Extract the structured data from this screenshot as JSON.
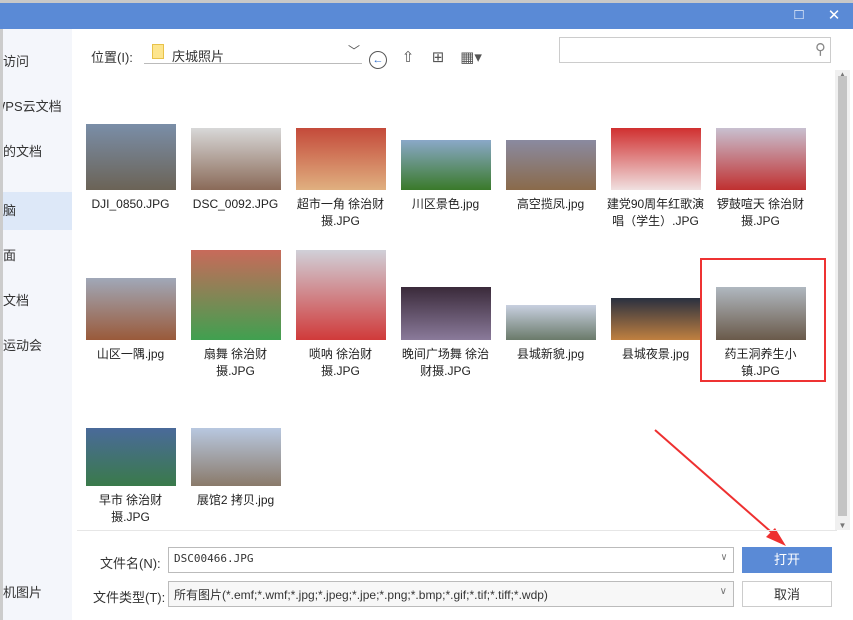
{
  "title_bar": {
    "maximize_icon": "□",
    "close_icon": "✕"
  },
  "sidebar": {
    "items": [
      {
        "label": "最近访问"
      },
      {
        "label": "WPS云文档"
      },
      {
        "label": "我的文档"
      },
      {
        "label": "此电脑"
      },
      {
        "label": "桌面"
      },
      {
        "label": "我的文档"
      },
      {
        "label": "校运动会"
      },
      {
        "label": "手机图片"
      }
    ]
  },
  "location": {
    "label": "位置(I):",
    "value": "庆城照片"
  },
  "files": [
    {
      "name": "DJI_0850.JPG",
      "colors": [
        "#7a8ea8",
        "#6b6356"
      ]
    },
    {
      "name": "DSC_0092.JPG",
      "colors": [
        "#d8d8d8",
        "#8a6a58"
      ]
    },
    {
      "name": "超市一角  徐治财摄.JPG",
      "colors": [
        "#c44a3a",
        "#e0b080"
      ]
    },
    {
      "name": "川区景色.jpg",
      "colors": [
        "#8aa8c8",
        "#3a7a2a"
      ]
    },
    {
      "name": "高空揽凤.jpg",
      "colors": [
        "#8a8aa0",
        "#8a6a4a"
      ]
    },
    {
      "name": "建党90周年红歌演唱（学生）.JPG",
      "colors": [
        "#d03030",
        "#f0e0e0"
      ]
    },
    {
      "name": "锣鼓喧天  徐治财摄.JPG",
      "colors": [
        "#c8c0d0",
        "#c03030"
      ]
    },
    {
      "name": "山区一隅.jpg",
      "colors": [
        "#a0a8b8",
        "#9a5a3a"
      ]
    },
    {
      "name": "扇舞  徐治财摄.JPG",
      "colors": [
        "#c86a5a",
        "#40a050"
      ]
    },
    {
      "name": "唢呐  徐治财摄.JPG",
      "colors": [
        "#d0d0d8",
        "#d03a3a"
      ]
    },
    {
      "name": "晚间广场舞  徐治财摄.JPG",
      "colors": [
        "#3a2a3a",
        "#8a7a9a"
      ]
    },
    {
      "name": "县城新貌.jpg",
      "colors": [
        "#c8d0e0",
        "#6a7a6a"
      ]
    },
    {
      "name": "县城夜景.jpg",
      "colors": [
        "#2a3040",
        "#c08040"
      ]
    },
    {
      "name": "药王洞养生小镇.JPG",
      "colors": [
        "#b0b8c0",
        "#6a5a4a"
      ]
    },
    {
      "name": "早市  徐治财摄.JPG",
      "colors": [
        "#4a6a9a",
        "#3a7a4a"
      ]
    },
    {
      "name": "展馆2 拷贝.jpg",
      "colors": [
        "#b8c8e0",
        "#8a7a6a"
      ]
    }
  ],
  "filename": {
    "label": "文件名(N):",
    "value": "DSC00466.JPG"
  },
  "filetype": {
    "label": "文件类型(T):",
    "value": "所有图片(*.emf;*.wmf;*.jpg;*.jpeg;*.jpe;*.png;*.bmp;*.gif;*.tif;*.tiff;*.wdp)"
  },
  "buttons": {
    "open": "打开",
    "cancel": "取消"
  }
}
